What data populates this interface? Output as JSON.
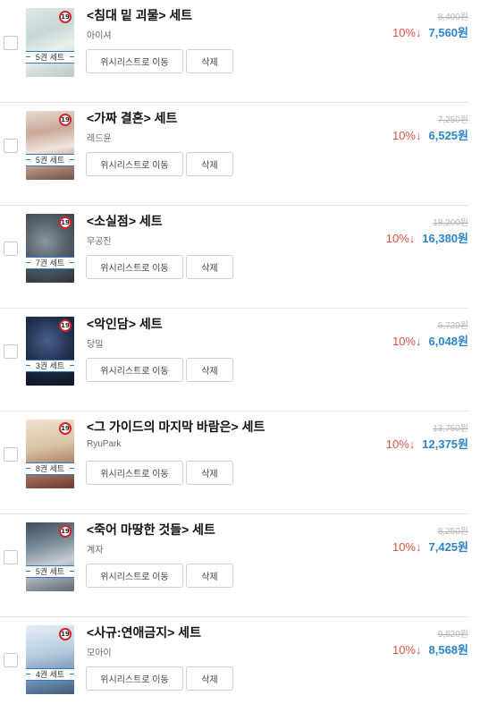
{
  "buttons": {
    "wishlist": "위시리스트로 이동",
    "delete": "삭제"
  },
  "age_badge": "19",
  "items": [
    {
      "title": "<침대 밑 괴물> 세트",
      "author": "아이셔",
      "set_count": "5권 세트",
      "original_price": "8,400원",
      "discount": "10%",
      "arrow": "↓",
      "price": "7,560원"
    },
    {
      "title": "<가짜 결혼> 세트",
      "author": "레드윤",
      "set_count": "5권 세트",
      "original_price": "7,250원",
      "discount": "10%",
      "arrow": "↓",
      "price": "6,525원"
    },
    {
      "title": "<소실점> 세트",
      "author": "무공진",
      "set_count": "7권 세트",
      "original_price": "18,200원",
      "discount": "10%",
      "arrow": "↓",
      "price": "16,380원"
    },
    {
      "title": "<악인담> 세트",
      "author": "당밀",
      "set_count": "3권 세트",
      "original_price": "6,720원",
      "discount": "10%",
      "arrow": "↓",
      "price": "6,048원"
    },
    {
      "title": "<그 가이드의 마지막 바람은> 세트",
      "author": "RyuPark",
      "set_count": "8권 세트",
      "original_price": "13,750원",
      "discount": "10%",
      "arrow": "↓",
      "price": "12,375원"
    },
    {
      "title": "<죽어 마땅한 것들> 세트",
      "author": "계자",
      "set_count": "5권 세트",
      "original_price": "8,250원",
      "discount": "10%",
      "arrow": "↓",
      "price": "7,425원"
    },
    {
      "title": "<사규:연애금지> 세트",
      "author": "모아이",
      "set_count": "4권 세트",
      "original_price": "9,520원",
      "discount": "10%",
      "arrow": "↓",
      "price": "8,568원"
    }
  ]
}
